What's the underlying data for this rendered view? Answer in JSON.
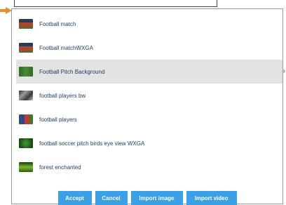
{
  "list": {
    "items": [
      {
        "label": "Football match",
        "thumb": "football-match-thumbnail-icon",
        "thumb_color": "#6b4a3a",
        "selected": false
      },
      {
        "label": "Football matchWXGA",
        "thumb": "football-match-wxga-thumbnail-icon",
        "thumb_color": "#5e4a3d",
        "selected": false
      },
      {
        "label": "Football Pitch Background",
        "thumb": "football-pitch-thumbnail-icon",
        "thumb_color": "#3d7a2a",
        "selected": true
      },
      {
        "label": "football players bw",
        "thumb": "football-players-bw-thumbnail-icon",
        "thumb_color": "#5a5a5a",
        "selected": false
      },
      {
        "label": "football players",
        "thumb": "football-players-thumbnail-icon",
        "thumb_color": "#b03a3a",
        "selected": false
      },
      {
        "label": "football soccer pitch birds eye view WXGA",
        "thumb": "soccer-pitch-birds-eye-thumbnail-icon",
        "thumb_color": "#1f5a1a",
        "selected": false
      },
      {
        "label": "forest enchanted",
        "thumb": "forest-enchanted-thumbnail-icon",
        "thumb_color": "#4a8a1a",
        "selected": false
      }
    ]
  },
  "buttons": {
    "accept": "Accept",
    "cancel": "Cancel",
    "import_image": "Import image",
    "import_video": "Import video"
  },
  "colors": {
    "accent": "#3aa0e8",
    "pointer_arrow": "#f08a24",
    "selected_row": "#e3e3e3",
    "label_text": "#1f3b5c"
  }
}
